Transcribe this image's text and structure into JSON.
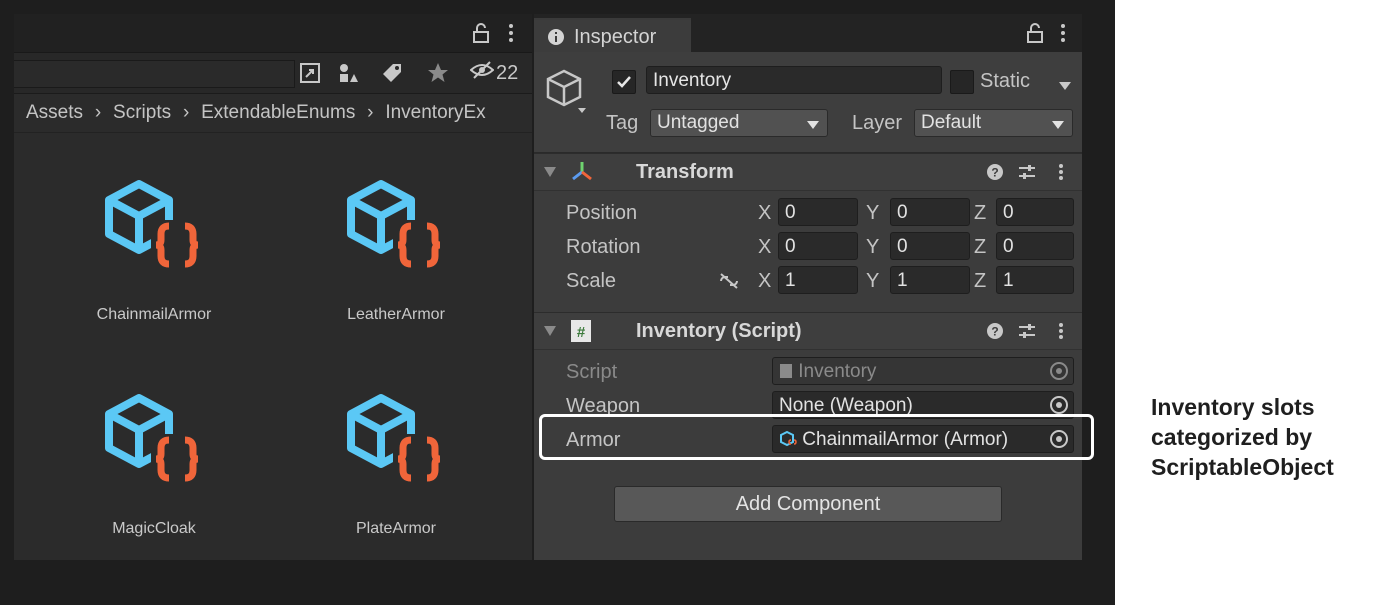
{
  "project": {
    "hidden_count": "22",
    "breadcrumb": [
      "Assets",
      "Scripts",
      "ExtendableEnums",
      "InventoryEx"
    ],
    "assets": [
      {
        "name": "ChainmailArmor"
      },
      {
        "name": "LeatherArmor"
      },
      {
        "name": "MagicCloak"
      },
      {
        "name": "PlateArmor"
      }
    ]
  },
  "inspector": {
    "tab_label": "Inspector",
    "gameobject": {
      "name": "Inventory",
      "active": true,
      "static_label": "Static",
      "tag_label": "Tag",
      "tag_value": "Untagged",
      "layer_label": "Layer",
      "layer_value": "Default"
    },
    "transform": {
      "title": "Transform",
      "rows": [
        {
          "label": "Position",
          "x": "0",
          "y": "0",
          "z": "0"
        },
        {
          "label": "Rotation",
          "x": "0",
          "y": "0",
          "z": "0"
        },
        {
          "label": "Scale",
          "x": "1",
          "y": "1",
          "z": "1"
        }
      ],
      "axis": {
        "x": "X",
        "y": "Y",
        "z": "Z"
      }
    },
    "script_component": {
      "title": "Inventory (Script)",
      "fields": [
        {
          "label": "Script",
          "value": "Inventory"
        },
        {
          "label": "Weapon",
          "value": "None (Weapon)"
        },
        {
          "label": "Armor",
          "value": "ChainmailArmor (Armor)"
        }
      ]
    },
    "add_component_label": "Add Component"
  },
  "caption": {
    "lines": [
      "Inventory slots",
      "categorized by",
      "ScriptableObject"
    ]
  },
  "colors": {
    "asset_cube": "#5bc8f5",
    "asset_braces": "#f0653a",
    "highlight": "#ffffff"
  },
  "icons": [
    "lock-icon",
    "kebab-menu-icon",
    "search-by-type-icon",
    "label-icon",
    "star-icon",
    "hidden-eye-icon",
    "cube-icon",
    "transform-icon",
    "script-icon",
    "help-icon",
    "presets-icon",
    "object-picker-icon"
  ]
}
